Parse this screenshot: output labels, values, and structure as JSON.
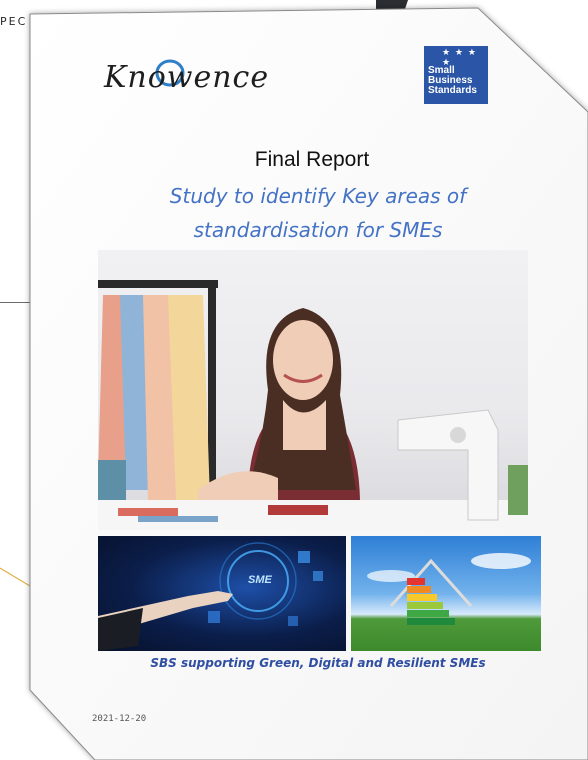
{
  "background": {
    "fragment_text": "PEC"
  },
  "cover": {
    "logo_left": "Knowence",
    "logo_right": {
      "line1": "Small",
      "line2": "Business",
      "line3": "Standards"
    },
    "title": "Final Report",
    "subtitle_line1": "Study to identify Key areas of",
    "subtitle_line2": "standardisation for SMEs",
    "image_label": "SME",
    "caption": "SBS supporting Green, Digital and Resilient SMEs",
    "date": "2021-12-20"
  },
  "colors": {
    "subtitle": "#4472c4",
    "caption": "#2f4ea2",
    "sbs_blue": "#2b55a6",
    "accent_line": "#e0b34a"
  }
}
